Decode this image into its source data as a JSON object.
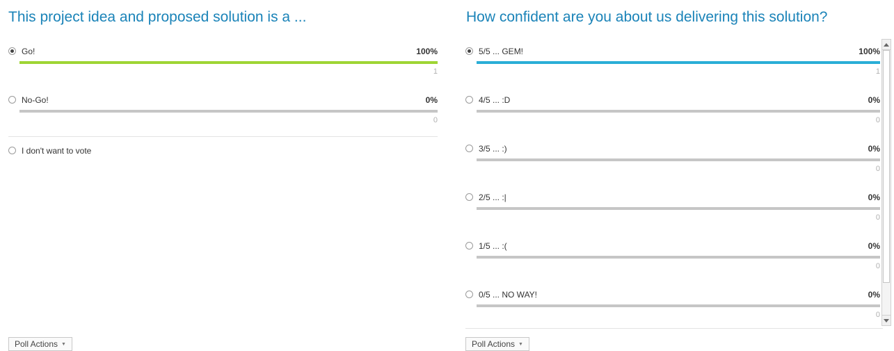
{
  "colors": {
    "title": "#1a83b8",
    "go_bar": "#9ed534",
    "confidence_bar": "#2aaed6",
    "empty_bar": "#c6c6c6"
  },
  "poll1": {
    "title": "This project idea and  proposed solution is a ...",
    "options": [
      {
        "label": "Go!",
        "percent": "100%",
        "count": "1",
        "fill": 1.0,
        "selected": true
      },
      {
        "label": "No-Go!",
        "percent": "0%",
        "count": "0",
        "fill": 0.0,
        "selected": false
      }
    ],
    "no_vote_label": "I don't want to vote",
    "actions_label": "Poll Actions"
  },
  "poll2": {
    "title": "How confident are you about us delivering this solution?",
    "options": [
      {
        "label": "5/5 ... GEM!",
        "percent": "100%",
        "count": "1",
        "fill": 1.0,
        "selected": true
      },
      {
        "label": "4/5 ... :D",
        "percent": "0%",
        "count": "0",
        "fill": 0.0,
        "selected": false
      },
      {
        "label": "3/5 ... :)",
        "percent": "0%",
        "count": "0",
        "fill": 0.0,
        "selected": false
      },
      {
        "label": "2/5 ... :|",
        "percent": "0%",
        "count": "0",
        "fill": 0.0,
        "selected": false
      },
      {
        "label": "1/5 ... :(",
        "percent": "0%",
        "count": "0",
        "fill": 0.0,
        "selected": false
      },
      {
        "label": "0/5 ... NO WAY!",
        "percent": "0%",
        "count": "0",
        "fill": 0.0,
        "selected": false
      }
    ],
    "actions_label": "Poll Actions"
  }
}
